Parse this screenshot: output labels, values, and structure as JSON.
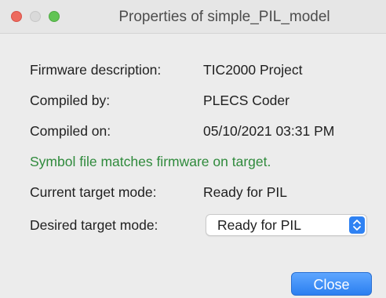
{
  "window": {
    "title": "Properties of simple_PIL_model"
  },
  "properties": {
    "firmware_description": {
      "label": "Firmware description:",
      "value": "TIC2000 Project"
    },
    "compiled_by": {
      "label": "Compiled by:",
      "value": "PLECS Coder"
    },
    "compiled_on": {
      "label": "Compiled on:",
      "value": "05/10/2021 03:31 PM"
    },
    "status_message": "Symbol file matches firmware on target.",
    "current_target_mode": {
      "label": "Current target mode:",
      "value": "Ready for PIL"
    },
    "desired_target_mode": {
      "label": "Desired target mode:",
      "selected": "Ready for PIL"
    }
  },
  "buttons": {
    "close_label": "Close"
  },
  "colors": {
    "status_green": "#2f8a3c",
    "accent_blue": "#2f82f3"
  }
}
